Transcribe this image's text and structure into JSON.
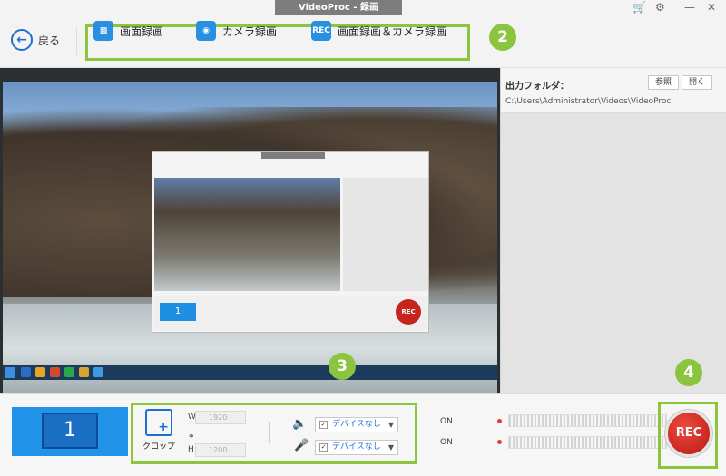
{
  "window": {
    "title": "VideoProc - 録画"
  },
  "titlebar": {
    "cart_icon": "cart-icon",
    "settings_icon": "gear-icon"
  },
  "toolbar": {
    "back_label": "戻る",
    "modes": [
      {
        "label": "画面録画",
        "icon": "screen-record-icon"
      },
      {
        "label": "カメラ録画",
        "icon": "camera-record-icon"
      },
      {
        "label": "画面録画＆カメラ録画",
        "icon": "REC"
      }
    ]
  },
  "badges": [
    "2",
    "3",
    "4"
  ],
  "output": {
    "label": "出力フォルダ：",
    "browse_label": "参照",
    "open_label": "開く",
    "path": "C:\\Users\\Administrator\\Videos\\VideoProc"
  },
  "bottom": {
    "screen_number": "1",
    "crop_label": "クロップ",
    "width_label": "W",
    "width_value": "1920",
    "height_label": "H",
    "height_value": "1200",
    "speaker_device": "デバイスなし",
    "mic_device": "デバイスなし",
    "speaker_state": "ON",
    "mic_state": "ON",
    "rec_label": "REC"
  },
  "colors": {
    "accent": "#2194ea",
    "highlight": "#8bc43f",
    "rec": "#c5241f"
  }
}
